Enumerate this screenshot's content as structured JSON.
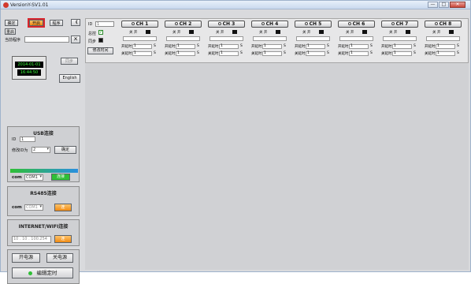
{
  "window": {
    "title": "VersionY-SV1.01",
    "min_label": "—",
    "max_label": "□",
    "close_label": "✕"
  },
  "left": {
    "btn_a": "确定",
    "btn_b": "开启",
    "btn_c": "程序",
    "btn_collapse": "《",
    "btn_d": "重启",
    "current_prog_label": "当前程序",
    "btn_pin": "ㄨ",
    "btn_sync": "同步",
    "date": "2014-01-01",
    "time": "16:44:50",
    "english_label": "English",
    "usb_title": "USB连接",
    "id_label": "ID",
    "id_value": "1",
    "change_id_label": "修改ID为",
    "change_id_value": "2",
    "confirm_label": "确定",
    "com_label": "com",
    "com_value": "COM1",
    "connect_label": "连接",
    "rs485_title": "RS485连接",
    "com2_label": "com",
    "com2_value": "COM1",
    "rs_connect_label": "连",
    "internet_title": "INTERNET/WIFI连接",
    "ip_value": "10 . 10 . 100.254",
    "net_connect_label": "连",
    "power_on_label": "开电源",
    "power_off_label": "关电源",
    "schedule_label": "编辑定时"
  },
  "main": {
    "id_label": "ID",
    "id_value": "1",
    "master_label": "总控",
    "sync_label": "同步",
    "modify_time_label": "修改时间",
    "channels": [
      {
        "name": "CH 1",
        "toggle": "关 开",
        "on_delay": "开延时",
        "off_delay": "关延时",
        "on_val": "1",
        "off_val": "1",
        "unit": "S"
      },
      {
        "name": "CH 2",
        "toggle": "关 开",
        "on_delay": "开延时",
        "off_delay": "关延时",
        "on_val": "1",
        "off_val": "1",
        "unit": "S"
      },
      {
        "name": "CH 3",
        "toggle": "关 开",
        "on_delay": "开延时",
        "off_delay": "关延时",
        "on_val": "1",
        "off_val": "1",
        "unit": "S"
      },
      {
        "name": "CH 4",
        "toggle": "关 开",
        "on_delay": "开延时",
        "off_delay": "关延时",
        "on_val": "1",
        "off_val": "1",
        "unit": "S"
      },
      {
        "name": "CH 5",
        "toggle": "关 开",
        "on_delay": "开延时",
        "off_delay": "关延时",
        "on_val": "1",
        "off_val": "1",
        "unit": "S"
      },
      {
        "name": "CH 6",
        "toggle": "关 开",
        "on_delay": "开延时",
        "off_delay": "关延时",
        "on_val": "1",
        "off_val": "1",
        "unit": "S"
      },
      {
        "name": "CH 7",
        "toggle": "关 开",
        "on_delay": "开延时",
        "off_delay": "关延时",
        "on_val": "1",
        "off_val": "1",
        "unit": "S"
      },
      {
        "name": "CH 8",
        "toggle": "关 开",
        "on_delay": "开延时",
        "off_delay": "关延时",
        "on_val": "1",
        "off_val": "1",
        "unit": "S"
      }
    ]
  },
  "colors": {
    "accent_orange": "#f08a12",
    "highlight_red": "#d9252b",
    "led_green": "#3cff3c",
    "status_green": "#2fbf36"
  }
}
